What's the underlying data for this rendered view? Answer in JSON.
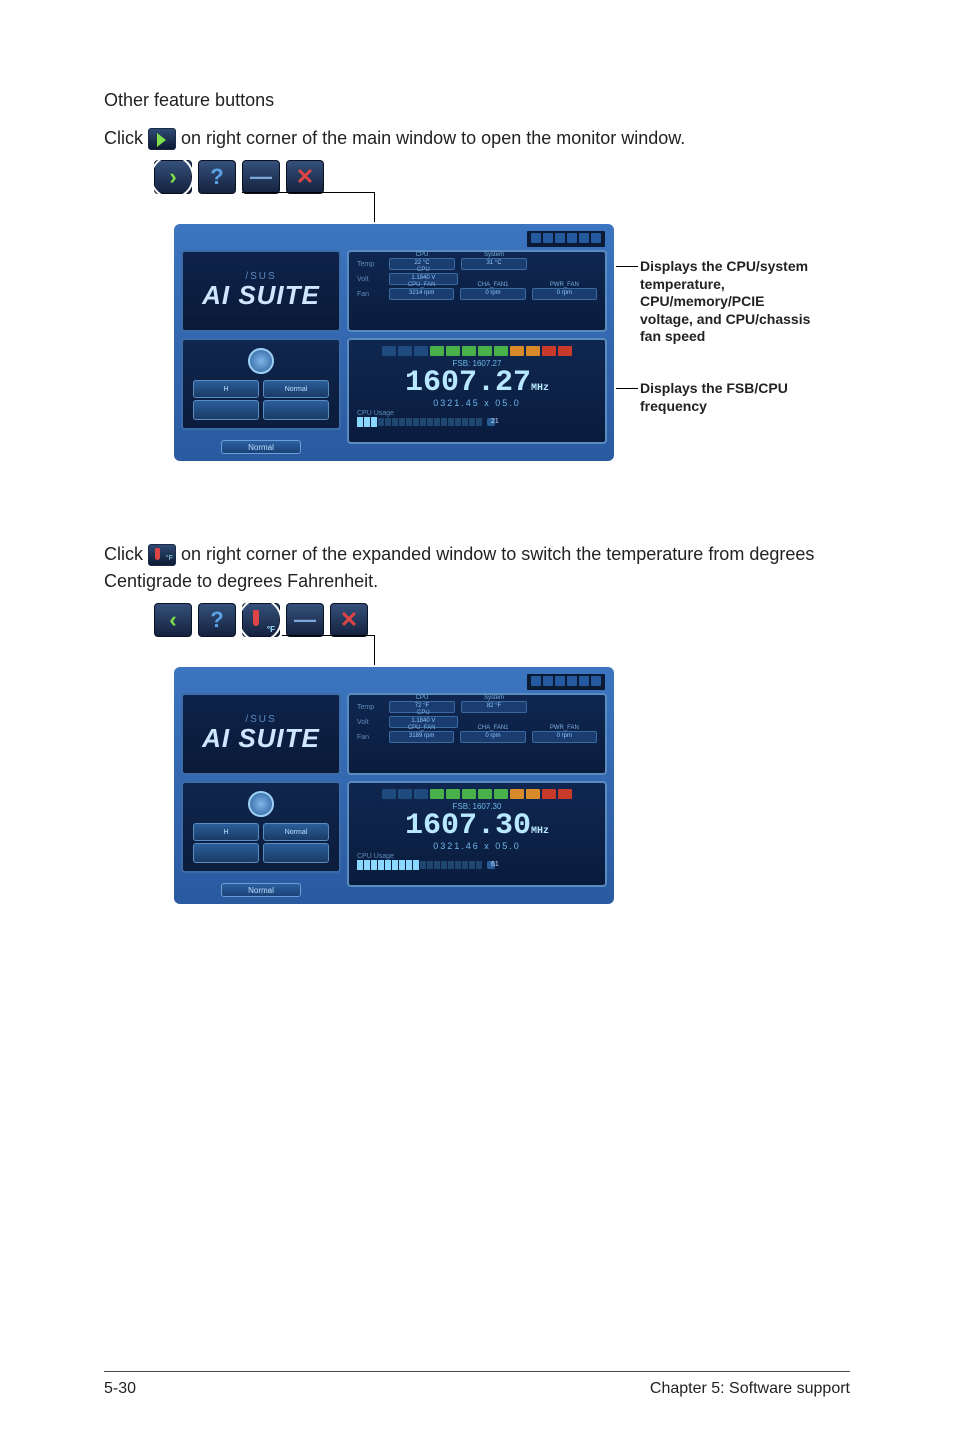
{
  "heading": "Other feature buttons",
  "para1_pre": "Click ",
  "para1_post": " on right corner of the main window to open the monitor window.",
  "para2_pre": "Click ",
  "para2_post": " on right corner of the expanded window to switch the temperature from degrees Centigrade to degrees Fahrenheit.",
  "callout1": "Displays the CPU/system temperature, CPU/memory/PCIE voltage, and CPU/chassis fan speed",
  "callout2": "Displays the FSB/CPU frequency",
  "suite1": {
    "brand": "/SUS",
    "logo": "AI SUITE",
    "status": "Normal",
    "sensors": {
      "temp": {
        "lab": "Temp",
        "cpu_lab": "CPU",
        "cpu": "22 °C",
        "sys_lab": "System",
        "sys": "31 °C"
      },
      "volt": {
        "lab": "Volt",
        "cpu_lab": "CPU",
        "cpu": "1.1840 V"
      },
      "fan": {
        "lab": "Fan",
        "cpu_lab": "CPU_FAN",
        "cpu": "3214 rpm",
        "cha_lab": "CHA_FAN1",
        "cha": "0 rpm",
        "pwr_lab": "PWR_FAN",
        "pwr": "0 rpm"
      }
    },
    "freq": {
      "fsb_line": "FSB: 1607.27",
      "big": "1607.27",
      "unit": "MHz",
      "sub": "0321.45 x 05.0",
      "usage_lab": "CPU Usage",
      "usage_pct": "21"
    }
  },
  "suite2": {
    "brand": "/SUS",
    "logo": "AI SUITE",
    "status": "Normal",
    "sensors": {
      "temp": {
        "lab": "Temp",
        "cpu_lab": "CPU",
        "cpu": "72 °F",
        "sys_lab": "System",
        "sys": "82 °F"
      },
      "volt": {
        "lab": "Volt",
        "cpu_lab": "CPU",
        "cpu": "1.1840 V"
      },
      "fan": {
        "lab": "Fan",
        "cpu_lab": "CPU_FAN",
        "cpu": "3189 rpm",
        "cha_lab": "CHA_FAN1",
        "cha": "0 rpm",
        "pwr_lab": "PWR_FAN",
        "pwr": "0 rpm"
      }
    },
    "freq": {
      "fsb_line": "FSB: 1607.30",
      "big": "1607.30",
      "unit": "MHz",
      "sub": "0321.46 x 05.0",
      "usage_lab": "CPU Usage",
      "usage_pct": "61"
    }
  },
  "footer_left": "5-30",
  "footer_right": "Chapter 5: Software support"
}
